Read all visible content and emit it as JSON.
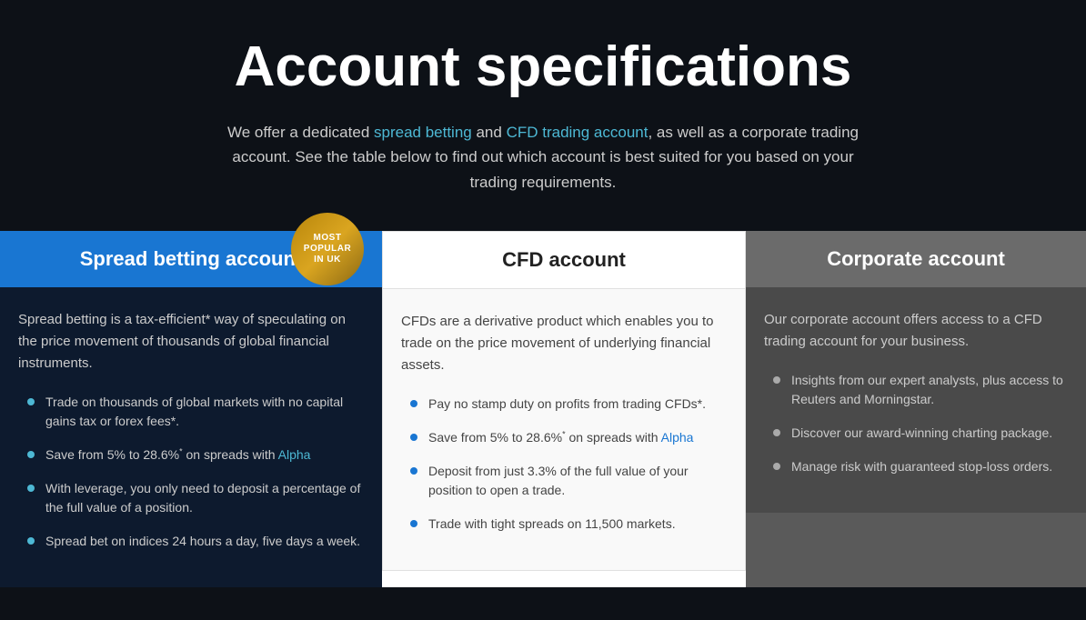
{
  "header": {
    "title": "Account specifications",
    "subtitle_plain1": "We offer a dedicated ",
    "subtitle_link1": "spread betting",
    "subtitle_plain2": " and ",
    "subtitle_link2": "CFD trading account",
    "subtitle_plain3": ", as well as a corporate trading account. See the table below to find out which account is best suited for you based on your trading requirements."
  },
  "columns": {
    "spread_betting": {
      "header": "Spread betting account",
      "badge": "MOST\nPOPULAR\nIN UK",
      "intro": "Spread betting is a tax-efficient* way of speculating on the price movement of thousands of global financial instruments.",
      "bullets": [
        "Trade on thousands of global markets with no capital gains tax or forex fees*.",
        "Save from 5% to 28.6%* on spreads with Alpha",
        "With leverage, you only need to deposit a percentage of the full value of a position.",
        "Spread bet on indices 24 hours a day, five days a week."
      ],
      "alpha_link": "Alpha"
    },
    "cfd": {
      "header": "CFD account",
      "intro": "CFDs are a derivative product which enables you to trade on the price movement of underlying financial assets.",
      "bullets": [
        "Pay no stamp duty on profits from trading CFDs*.",
        "Save from 5% to 28.6%* on spreads with Alpha",
        "Deposit from just 3.3% of the full value of your position to open a trade.",
        "Trade with tight spreads on 11,500 markets."
      ],
      "alpha_link": "Alpha"
    },
    "corporate": {
      "header": "Corporate account",
      "intro": "Our corporate account offers access to a CFD trading account for your business.",
      "bullets": [
        "Insights from our expert analysts, plus access to Reuters and Morningstar.",
        "Discover our award-winning charting package.",
        "Manage risk with guaranteed stop-loss orders."
      ]
    }
  }
}
